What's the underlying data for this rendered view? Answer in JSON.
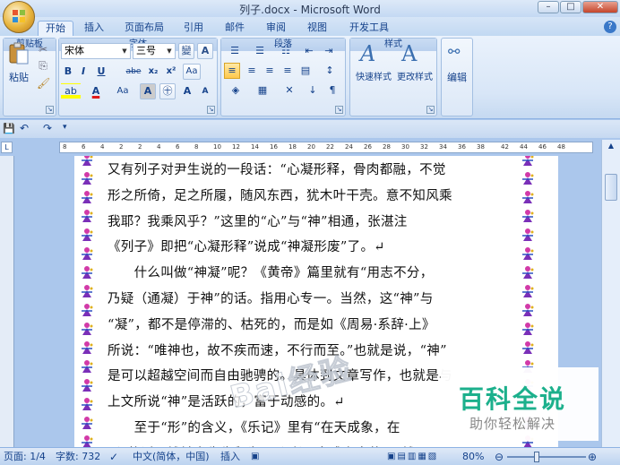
{
  "window": {
    "title": "列子.docx - Microsoft Word"
  },
  "tabs": [
    "开始",
    "插入",
    "页面布局",
    "引用",
    "邮件",
    "审阅",
    "视图",
    "开发工具"
  ],
  "ribbon": {
    "clipboard": {
      "paste": "粘贴",
      "label": "剪贴板"
    },
    "font": {
      "name": "宋体",
      "size": "三号",
      "label": "字体",
      "size_glyph": "變",
      "bold": "B",
      "italic": "I",
      "underline": "U",
      "strike": "abe",
      "sub": "x₂",
      "sup": "x²",
      "font_color": "A",
      "highlight": "A",
      "clear": "Aa",
      "grow": "A",
      "shrink": "A",
      "char_shade": "A",
      "enclose": "㊉"
    },
    "paragraph": {
      "label": "段落"
    },
    "styles": {
      "quick": "快速样式",
      "change": "更改样式",
      "label": "样式"
    },
    "editing": {
      "label": "编辑"
    }
  },
  "ruler": {
    "ticks": [
      "8",
      "6",
      "4",
      "2",
      "2",
      "4",
      "6",
      "8",
      "10",
      "12",
      "14",
      "16",
      "18",
      "20",
      "22",
      "24",
      "26",
      "28",
      "30",
      "32",
      "34",
      "36",
      "38",
      "42",
      "44",
      "46",
      "48"
    ]
  },
  "document": {
    "lines": [
      "又有列子对尹生说的一段话：“心凝形释，骨肉都融，不觉",
      "形之所倚，足之所履，随风东西，犹木叶干壳。意不知风乘",
      "我耶？我乘风乎？”这里的“心”与“神”相通，张湛注",
      "《列子》即把“心凝形释”说成“神凝形废”了。↵",
      "    什么叫做“神凝”呢？《黄帝》篇里就有“用志不分，",
      "乃疑（通凝）于神”的话。指用心专一。当然，这“神”与",
      "“凝”，都不是停滞的、枯死的，而是如《周易·系辞·上》",
      "所说：“唯神也，故不疾而速，不行而至。”也就是说，“神”",
      "是可以超越空间而自由驰骋的。具体到文章写作，也就是与",
      "上文所说“神”是活跃的，富于动感的。↵",
      "    至于“形”的含义，《乐记》里有“在天成象，在",
      "形”的话，钱钟书先生释为“‘形’者，完成之定状”，钱"
    ]
  },
  "status": {
    "page": "页面: 1/4",
    "words": "字数: 732",
    "lang": "中文(简体，中国)",
    "insert": "插入",
    "zoom": "80%"
  },
  "watermark": {
    "title": "百科全说",
    "subtitle": "助你轻松解决",
    "baidu": "Bai经验"
  }
}
